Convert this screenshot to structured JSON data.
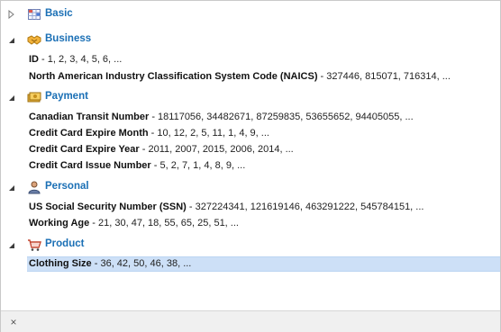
{
  "categories": [
    {
      "label": "Basic",
      "icon": "grid-table-icon",
      "expanded": false,
      "fields": []
    },
    {
      "label": "Business",
      "icon": "handshake-icon",
      "expanded": true,
      "fields": [
        {
          "name": "ID",
          "values": "1, 2, 3, 4, 5, 6, ..."
        },
        {
          "name": "North American Industry Classification System Code (NAICS)",
          "values": "327446, 815071, 716314, ..."
        }
      ]
    },
    {
      "label": "Payment",
      "icon": "money-icon",
      "expanded": true,
      "fields": [
        {
          "name": "Canadian Transit Number",
          "values": "18117056, 34482671, 87259835, 53655652, 94405055, ..."
        },
        {
          "name": "Credit Card Expire Month",
          "values": "10, 12, 2, 5, 11, 1, 4, 9, ..."
        },
        {
          "name": "Credit Card Expire Year",
          "values": "2011, 2007, 2015, 2006, 2014, ..."
        },
        {
          "name": "Credit Card Issue Number",
          "values": "5, 2, 7, 1, 4, 8, 9, ..."
        }
      ]
    },
    {
      "label": "Personal",
      "icon": "person-icon",
      "expanded": true,
      "fields": [
        {
          "name": "US Social Security Number (SSN)",
          "values": "327224341, 121619146, 463291222, 545784151, ..."
        },
        {
          "name": "Working Age",
          "values": "21, 30, 47, 18, 55, 65, 25, 51, ..."
        }
      ]
    },
    {
      "label": "Product",
      "icon": "shopping-cart-icon",
      "expanded": true,
      "fields": [
        {
          "name": "Clothing Size",
          "values": "36, 42, 50, 46, 38, ...",
          "selected": true
        }
      ]
    }
  ],
  "separator": " - ",
  "footer": {
    "close_label": "×"
  },
  "colors": {
    "category_label": "#1a6fb5",
    "selection": "#cde0f7"
  }
}
